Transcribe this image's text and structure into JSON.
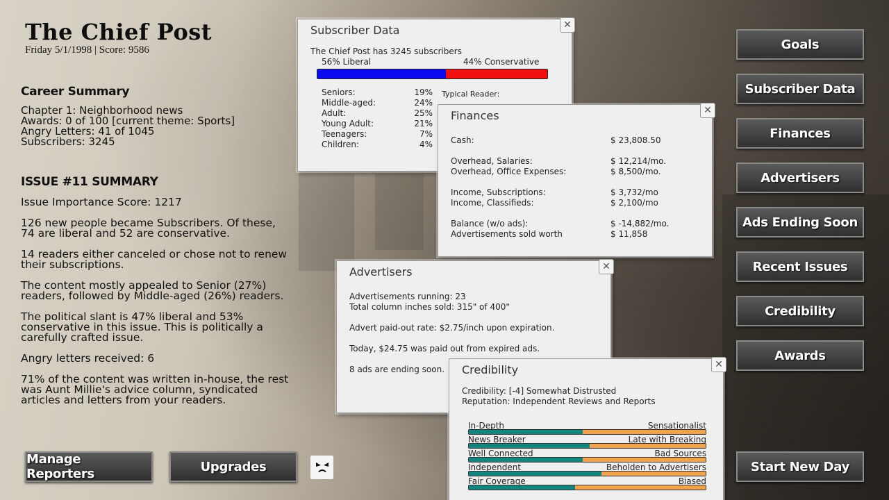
{
  "masthead": {
    "logo": "The Chief Post",
    "dateline": "Friday 5/1/1998 | Score: 9586"
  },
  "career": {
    "heading": "Career Summary",
    "lines": [
      "Chapter 1: Neighborhood news",
      "Awards: 0 of 100 [current theme: Sports]",
      "Angry Letters: 41 of 1045",
      "Subscribers: 3245"
    ]
  },
  "issue": {
    "heading": "ISSUE #11 SUMMARY",
    "paras": [
      "Issue Importance Score: 1217",
      "126 new people became Subscribers. Of these, 74 are liberal and 52 are conservative.",
      "14 readers either canceled or chose not to renew their subscriptions.",
      "The content mostly appealed to Senior (27%) readers, followed by Middle-aged (26%) readers.",
      "The political slant is 47% liberal and 53% conservative in this issue. This is politically a carefully crafted issue.",
      "Angry letters received: 6",
      "71% of the content was written in-house, the rest was Aunt Millie's advice column, syndicated articles and letters from your readers."
    ]
  },
  "buttons": {
    "goals": "Goals",
    "subscriber_data": "Subscriber Data",
    "finances": "Finances",
    "advertisers": "Advertisers",
    "ads_ending": "Ads Ending Soon",
    "recent_issues": "Recent Issues",
    "credibility": "Credibility",
    "awards": "Awards",
    "start_new_day": "Start New Day",
    "manage_reporters": "Manage Reporters",
    "upgrades": "Upgrades"
  },
  "subscriber_panel": {
    "title": "Subscriber Data",
    "summary": "The Chief Post has 3245 subscribers",
    "liberal_label": "56% Liberal",
    "conservative_label": "44% Conservative",
    "liberal_fraction": 0.56,
    "ages": [
      {
        "label": "Seniors:",
        "value": "19%"
      },
      {
        "label": "Middle-aged:",
        "value": "24%"
      },
      {
        "label": "Adult:",
        "value": "25%"
      },
      {
        "label": "Young Adult:",
        "value": "21%"
      },
      {
        "label": "Teenagers:",
        "value": "7%"
      },
      {
        "label": "Children:",
        "value": "4%"
      }
    ],
    "typical_reader": "Typical Reader:"
  },
  "finances_panel": {
    "title": "Finances",
    "groups": [
      [
        {
          "label": "Cash:",
          "value": "$ 23,808.50"
        }
      ],
      [
        {
          "label": "Overhead, Salaries:",
          "value": "$ 12,214/mo."
        },
        {
          "label": "Overhead, Office Expenses:",
          "value": "$ 8,500/mo."
        }
      ],
      [
        {
          "label": "Income, Subscriptions:",
          "value": "$ 3,732/mo"
        },
        {
          "label": "Income, Classifieds:",
          "value": "$ 2,100/mo"
        }
      ],
      [
        {
          "label": "Balance (w/o ads):",
          "value": "$ -14,882/mo."
        },
        {
          "label": "Advertisements sold worth",
          "value": "$ 11,858"
        }
      ]
    ]
  },
  "advertisers_panel": {
    "title": "Advertisers",
    "running": "Advertisements running: 23",
    "inches": "Total column inches sold: 315\" of 400\"",
    "rate": "Advert paid-out rate: $2.75/inch upon expiration.",
    "paid_today": "Today, $24.75 was paid out from expired ads.",
    "ending": "8 ads are ending soon."
  },
  "credibility_panel": {
    "title": "Credibility",
    "credibility": "Credibility: [-4] Somewhat Distrusted",
    "reputation": "Reputation: Independent Reviews and Reports",
    "scales": [
      {
        "left": "In-Depth",
        "right": "Sensationalist",
        "value": 0.48
      },
      {
        "left": "News Breaker",
        "right": "Late with Breaking",
        "value": 0.51
      },
      {
        "left": "Well Connected",
        "right": "Bad Sources",
        "value": 0.48
      },
      {
        "left": "Independent",
        "right": "Beholden to Advertisers",
        "value": 0.56
      },
      {
        "left": "Fair Coverage",
        "right": "Biased",
        "value": 0.45
      }
    ]
  },
  "colors": {
    "liberal": "#0a0af0",
    "conservative": "#f01010",
    "teal": "#14857f",
    "orange": "#f2a24d"
  }
}
